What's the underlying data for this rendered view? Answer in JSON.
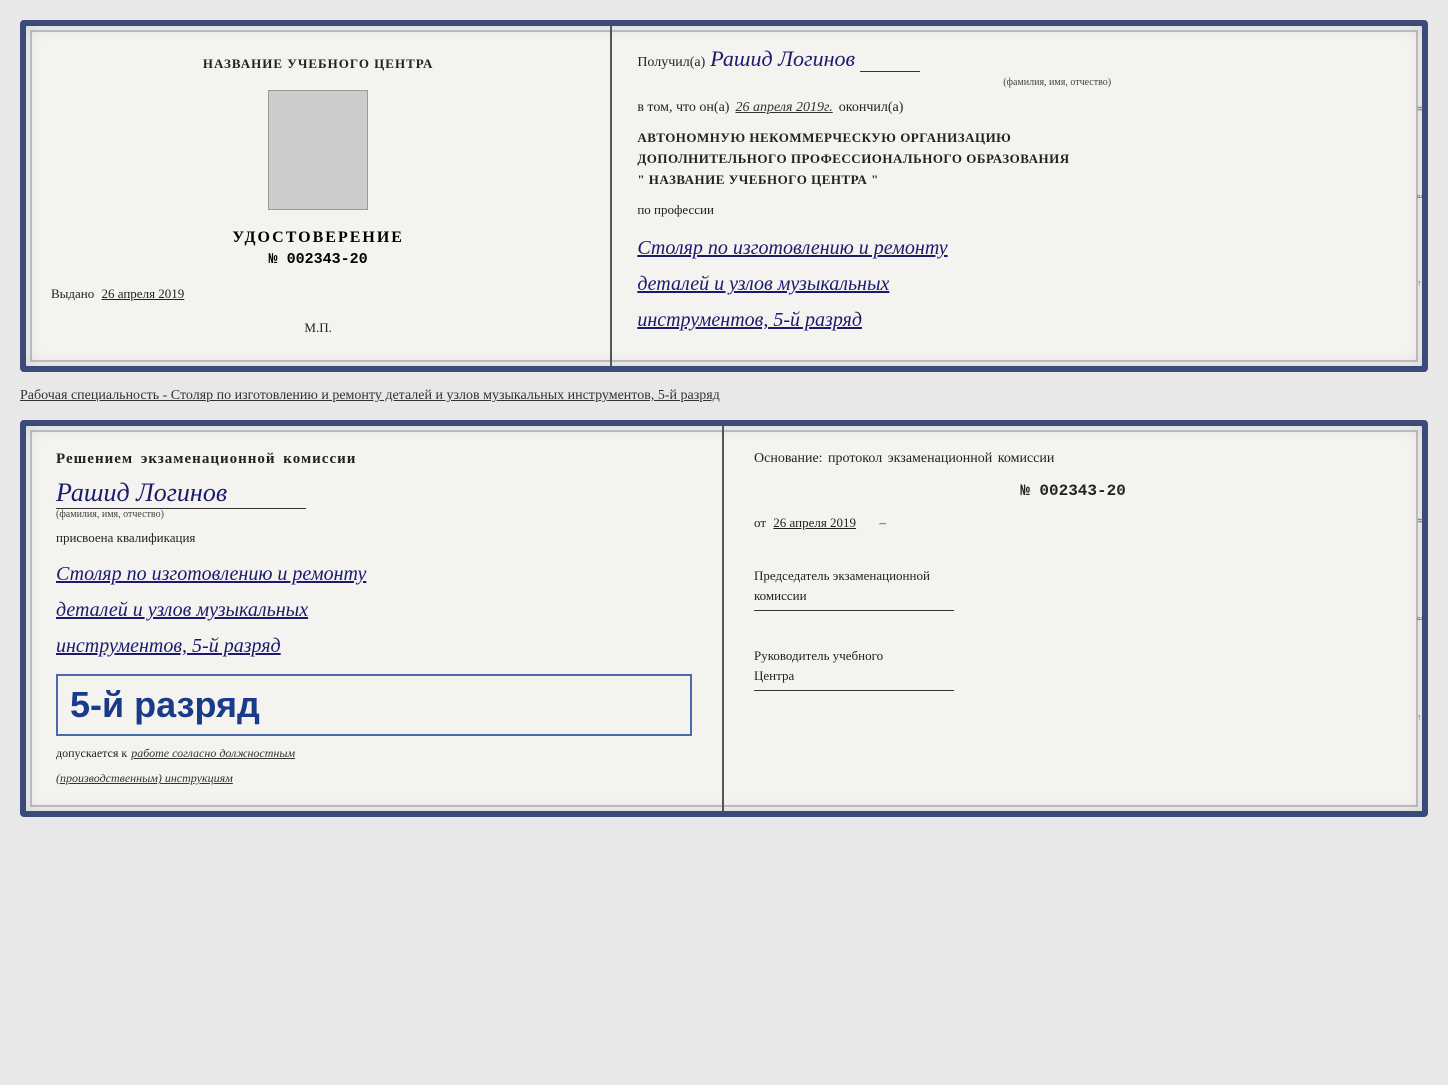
{
  "cert1": {
    "left": {
      "org_name": "НАЗВАНИЕ УЧЕБНОГО ЦЕНТРА",
      "cert_label": "УДОСТОВЕРЕНИЕ",
      "cert_number": "№ 002343-20",
      "issued_label": "Выдано",
      "issued_date": "26 апреля 2019",
      "stamp_label": "М.П."
    },
    "right": {
      "received_prefix": "Получил(а)",
      "recipient_name": "Рашид Логинов",
      "fio_label": "(фамилия, имя, отчество)",
      "date_prefix": "в том, что он(а)",
      "date_value": "26 апреля 2019г.",
      "date_suffix": "окончил(а)",
      "org_line1": "АВТОНОМНУЮ НЕКОММЕРЧЕСКУЮ ОРГАНИЗАЦИЮ",
      "org_line2": "ДОПОЛНИТЕЛЬНОГО ПРОФЕССИОНАЛЬНОГО ОБРАЗОВАНИЯ",
      "org_line3": "\" НАЗВАНИЕ УЧЕБНОГО ЦЕНТРА \"",
      "profession_label": "по профессии",
      "profession_line1": "Столяр по изготовлению и ремонту",
      "profession_line2": "деталей и узлов музыкальных",
      "profession_line3": "инструментов, 5-й разряд"
    }
  },
  "specialty_text": "Рабочая специальность - Столяр по изготовлению и ремонту деталей и узлов музыкальных инструментов, 5-й разряд",
  "cert2": {
    "left": {
      "decision_prefix": "Решением экзаменационной комиссии",
      "recipient_name": "Рашид Логинов",
      "fio_label": "(фамилия, имя, отчество)",
      "qualified_label": "присвоена квалификация",
      "qualification_line1": "Столяр по изготовлению и ремонту",
      "qualification_line2": "деталей и узлов музыкальных",
      "qualification_line3": "инструментов, 5-й разряд",
      "rank_big": "5-й разряд",
      "allowed_prefix": "допускается к",
      "allowed_text": "работе согласно должностным",
      "allowed_text2": "(производственным) инструкциям"
    },
    "right": {
      "basis_label": "Основание: протокол экзаменационной комиссии",
      "protocol_number": "№  002343-20",
      "date_prefix": "от",
      "date_value": "26 апреля 2019",
      "chairman_line1": "Председатель экзаменационной",
      "chairman_line2": "комиссии",
      "director_line1": "Руководитель учебного",
      "director_line2": "Центра"
    }
  }
}
